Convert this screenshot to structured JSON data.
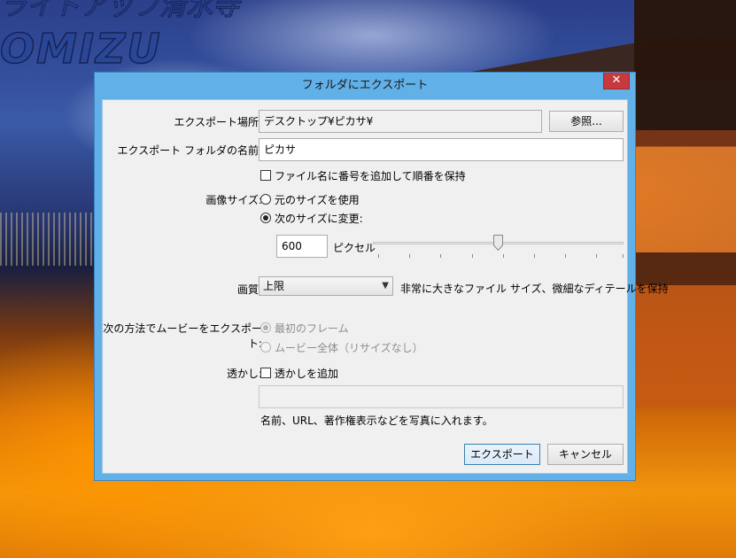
{
  "background": {
    "title_top": "ライトアップ清水寺",
    "title_main": "OMIZU"
  },
  "dialog": {
    "title": "フォルダにエクスポート",
    "close_glyph": "✕",
    "export_location": {
      "label": "エクスポート場所:",
      "value": "デスクトップ¥ピカサ¥",
      "browse_label": "参照..."
    },
    "folder_name": {
      "label": "エクスポート フォルダの名前:",
      "value": "ピカサ"
    },
    "keep_order": {
      "label": "ファイル名に番号を追加して順番を保持",
      "checked": false
    },
    "image_size": {
      "label": "画像サイズ:",
      "options": [
        {
          "label": "元のサイズを使用",
          "checked": false
        },
        {
          "label": "次のサイズに変更:",
          "checked": true
        }
      ],
      "size_value": "600",
      "unit": "ピクセル",
      "slider_fraction": 0.5
    },
    "quality": {
      "label": "画質:",
      "selected": "上限",
      "description": "非常に大きなファイル サイズ、微細なディテールを保持"
    },
    "movie_export": {
      "label": "次の方法でムービーをエクスポート:",
      "options": [
        {
          "label": "最初のフレーム",
          "checked": true,
          "disabled": true
        },
        {
          "label": "ムービー全体（リサイズなし）",
          "checked": false,
          "disabled": true
        }
      ]
    },
    "watermark": {
      "label": "透かし:",
      "checkbox_label": "透かしを追加",
      "checked": false,
      "text_value": "",
      "hint": "名前、URL、著作権表示などを写真に入れます。"
    },
    "buttons": {
      "export": "エクスポート",
      "cancel": "キャンセル"
    }
  }
}
